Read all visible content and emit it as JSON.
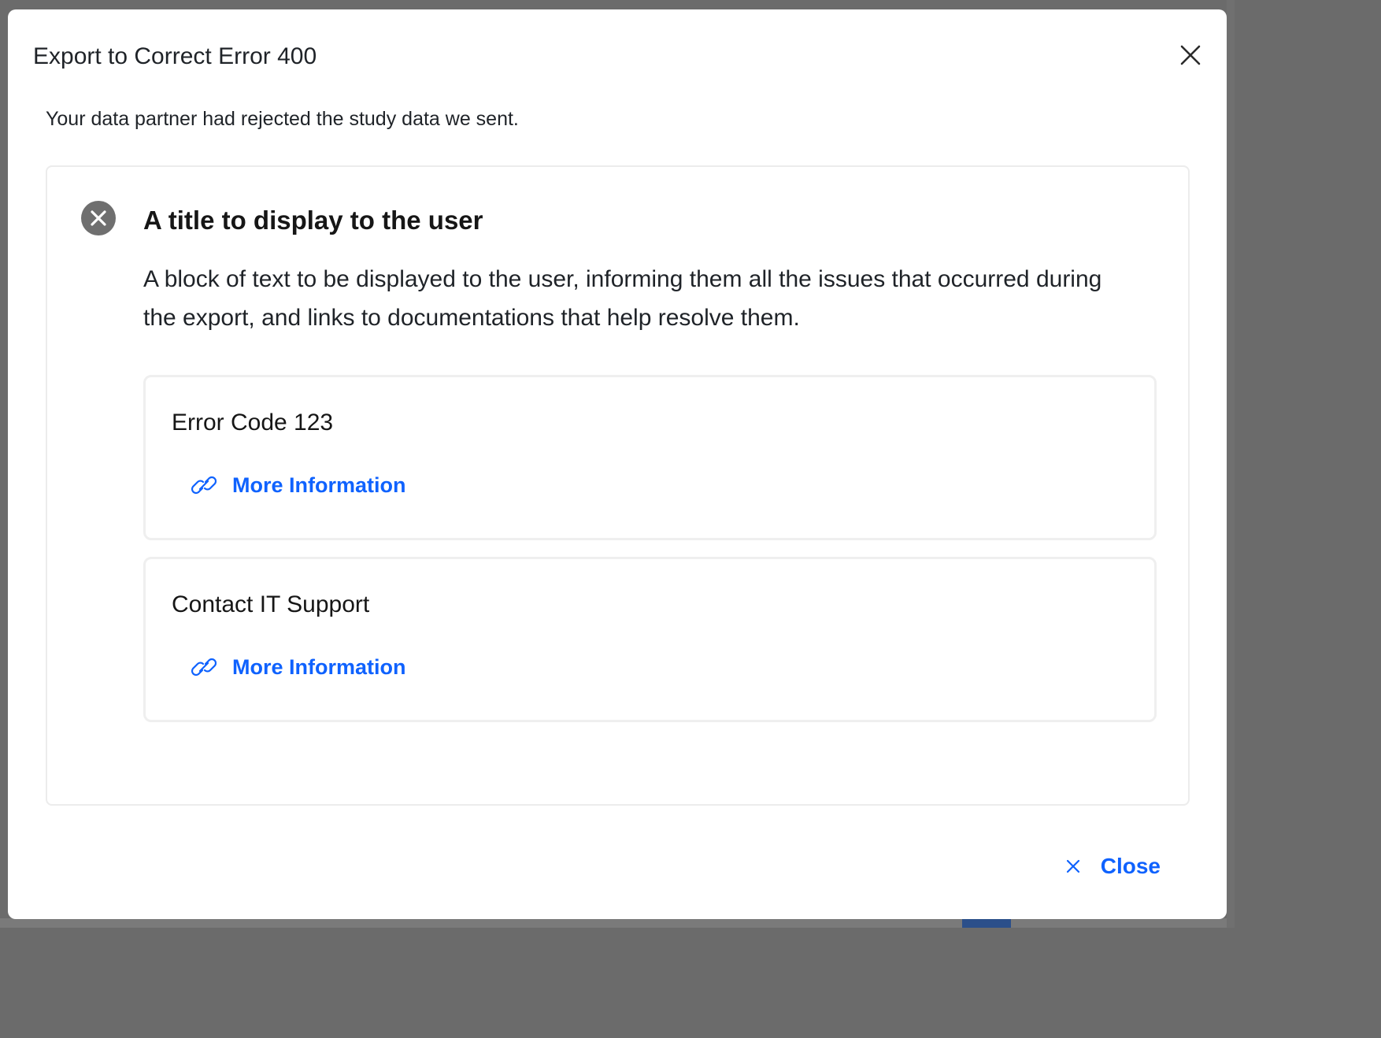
{
  "modal": {
    "title": "Export to Correct Error 400",
    "subtitle": "Your data partner had rejected the study data we sent.",
    "close_icon": "close-icon"
  },
  "error_card": {
    "icon": "error-circle-icon",
    "title": "A title to display to the user",
    "body": "A block of text to be displayed to the user, informing them all the issues that occurred during the export, and links to documentations that help resolve them.",
    "items": [
      {
        "title": "Error Code 123",
        "link_label": "More Information",
        "link_icon": "link-icon"
      },
      {
        "title": "Contact IT Support",
        "link_label": "More Information",
        "link_icon": "link-icon"
      }
    ]
  },
  "footer": {
    "close_label": "Close",
    "close_icon": "close-icon"
  },
  "colors": {
    "accent": "#0f62fe",
    "overlay": "#6b6b6b",
    "error_icon": "#6f6f6f"
  }
}
